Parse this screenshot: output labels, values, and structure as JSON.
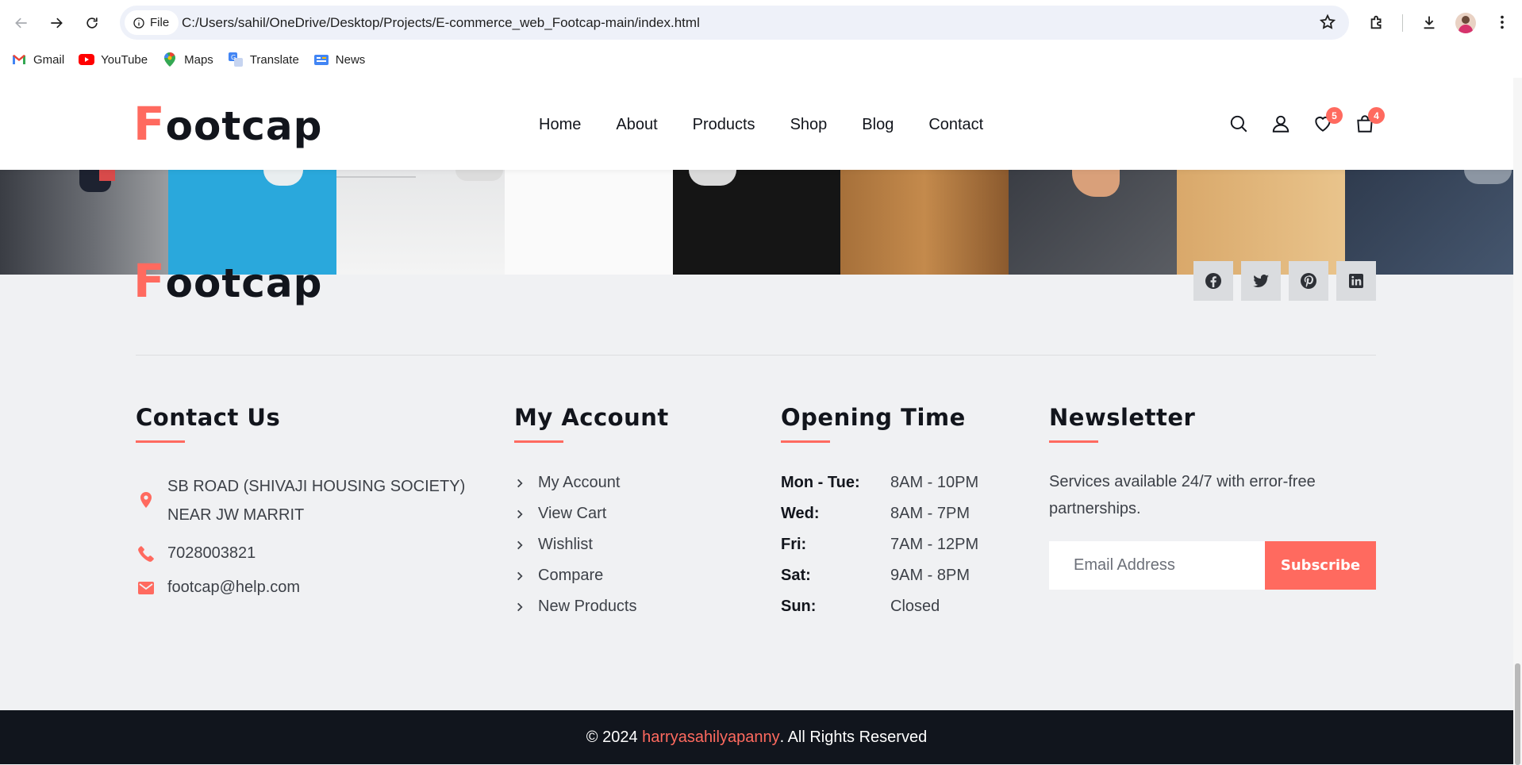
{
  "browser": {
    "file_chip": "File",
    "url": "C:/Users/sahil/OneDrive/Desktop/Projects/E-commerce_web_Footcap-main/index.html",
    "bookmarks": [
      {
        "label": "Gmail",
        "icon": "gmail-icon"
      },
      {
        "label": "YouTube",
        "icon": "youtube-icon"
      },
      {
        "label": "Maps",
        "icon": "maps-icon"
      },
      {
        "label": "Translate",
        "icon": "translate-icon"
      },
      {
        "label": "News",
        "icon": "news-icon"
      }
    ]
  },
  "header": {
    "logo_first": "F",
    "logo_rest": "ootcap",
    "nav": [
      "Home",
      "About",
      "Products",
      "Shop",
      "Blog",
      "Contact"
    ],
    "wishlist_count": "5",
    "cart_count": "4"
  },
  "footer": {
    "logo_first": "F",
    "logo_rest": "ootcap",
    "social": [
      "facebook-icon",
      "twitter-icon",
      "pinterest-icon",
      "linkedin-icon"
    ],
    "contact": {
      "title": "Contact Us",
      "address_line1": "SB ROAD (SHIVAJI HOUSING SOCIETY)",
      "address_line2": "NEAR JW MARRIT",
      "phone": "7028003821",
      "email": "footcap@help.com"
    },
    "account": {
      "title": "My Account",
      "links": [
        "My Account",
        "View Cart",
        "Wishlist",
        "Compare",
        "New Products"
      ]
    },
    "hours": {
      "title": "Opening Time",
      "rows": [
        {
          "day": "Mon - Tue:",
          "time": "8AM - 10PM"
        },
        {
          "day": "Wed:",
          "time": "8AM - 7PM"
        },
        {
          "day": "Fri:",
          "time": "7AM - 12PM"
        },
        {
          "day": "Sat:",
          "time": "9AM - 8PM"
        },
        {
          "day": "Sun:",
          "time": "Closed"
        }
      ]
    },
    "newsletter": {
      "title": "Newsletter",
      "text": "Services available 24/7 with error-free partnerships.",
      "placeholder": "Email Address",
      "button": "Subscribe"
    },
    "copyright_prefix": "© 2024 ",
    "copyright_name": "harryasahilyapanny",
    "copyright_suffix": ". All Rights Reserved"
  },
  "colors": {
    "accent": "#ff6a5f",
    "dark": "#12151c",
    "footer_bg": "#f0f1f3",
    "bottom_bar": "#11151d"
  }
}
